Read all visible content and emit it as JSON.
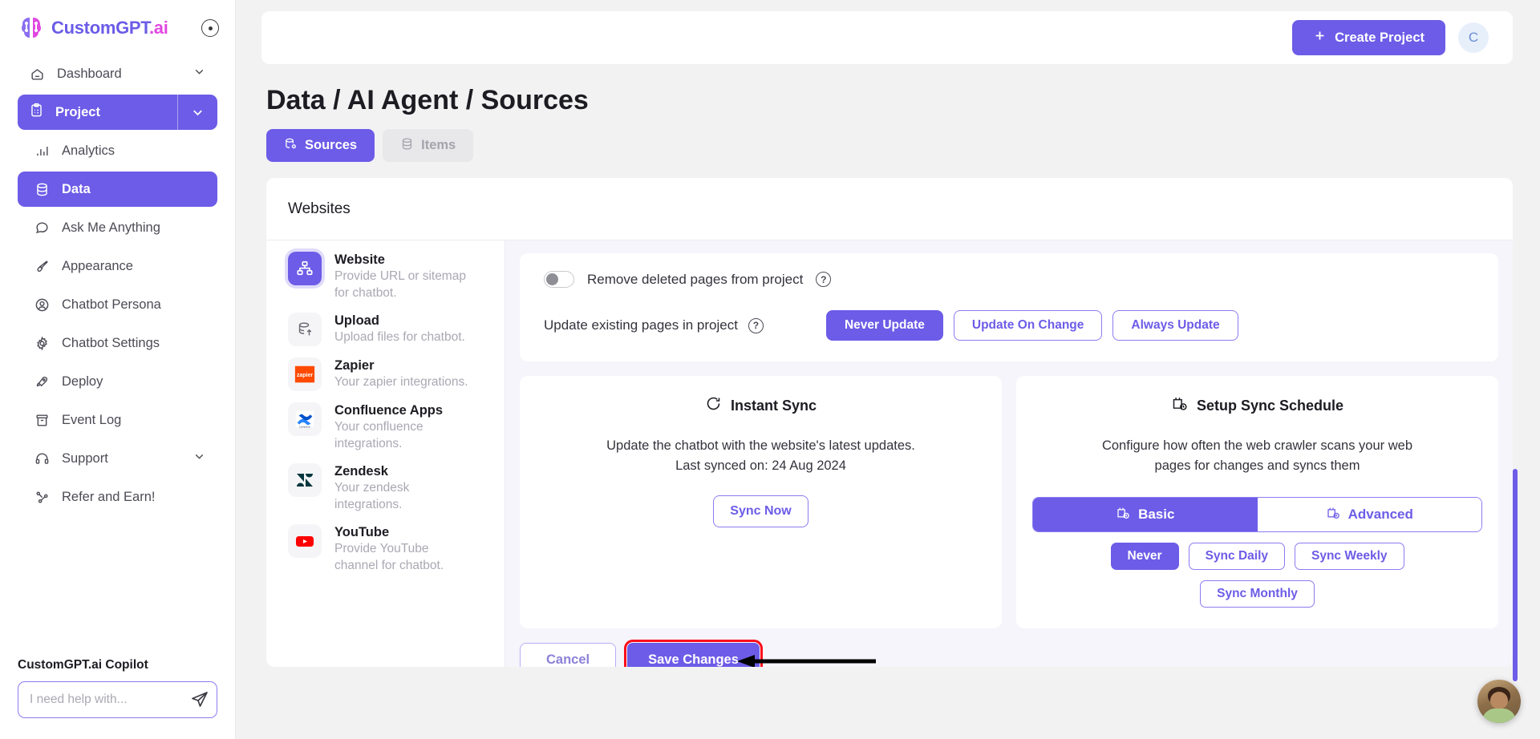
{
  "brand": {
    "name_part1": "CustomGPT",
    "name_part2": ".ai",
    "help_icon": "info-dot-icon"
  },
  "sidebar": {
    "items": [
      {
        "label": "Dashboard",
        "icon": "home-icon",
        "state": "default",
        "chevron": true
      },
      {
        "label": "Project",
        "icon": "clipboard-icon",
        "state": "active",
        "chevron": true
      },
      {
        "label": "Analytics",
        "icon": "bar-chart-icon",
        "state": "sub"
      },
      {
        "label": "Data",
        "icon": "database-icon",
        "state": "active-sub"
      },
      {
        "label": "Ask Me Anything",
        "icon": "chat-bubble-icon",
        "state": "sub"
      },
      {
        "label": "Appearance",
        "icon": "paint-brush-icon",
        "state": "sub"
      },
      {
        "label": "Chatbot Persona",
        "icon": "user-circle-icon",
        "state": "sub"
      },
      {
        "label": "Chatbot Settings",
        "icon": "gear-icon",
        "state": "sub"
      },
      {
        "label": "Deploy",
        "icon": "rocket-icon",
        "state": "sub"
      },
      {
        "label": "Event Log",
        "icon": "archive-icon",
        "state": "sub"
      },
      {
        "label": "Support",
        "icon": "headset-icon",
        "state": "sub",
        "chevron": true
      },
      {
        "label": "Refer and Earn!",
        "icon": "share-nodes-icon",
        "state": "sub"
      }
    ],
    "copilot": {
      "title": "CustomGPT.ai Copilot",
      "placeholder": "I need help with...",
      "value": "",
      "send_icon": "paper-plane-icon"
    }
  },
  "topbar": {
    "create_label": "Create Project",
    "create_icon": "plus-icon",
    "avatar_initial": "C"
  },
  "page": {
    "title": "Data / AI Agent / Sources",
    "tabs": [
      {
        "label": "Sources",
        "icon": "database-gear-icon",
        "active": true
      },
      {
        "label": "Items",
        "icon": "database-icon",
        "active": false
      }
    ],
    "panel_title": "Websites"
  },
  "sources": [
    {
      "name": "Website",
      "desc": "Provide URL or sitemap for chatbot.",
      "icon": "sitemap-icon",
      "selected": true
    },
    {
      "name": "Upload",
      "desc": "Upload files for chatbot.",
      "icon": "database-upload-icon",
      "selected": false
    },
    {
      "name": "Zapier",
      "desc": "Your zapier integrations.",
      "icon": "zapier-logo-icon",
      "selected": false
    },
    {
      "name": "Confluence Apps",
      "desc": "Your confluence integrations.",
      "icon": "confluence-logo-icon",
      "selected": false
    },
    {
      "name": "Zendesk",
      "desc": "Your zendesk integrations.",
      "icon": "zendesk-logo-icon",
      "selected": false
    },
    {
      "name": "YouTube",
      "desc": "Provide YouTube channel for chatbot.",
      "icon": "youtube-logo-icon",
      "selected": false
    }
  ],
  "settings": {
    "remove_deleted_label": "Remove deleted pages from project",
    "remove_deleted_enabled": false,
    "update_existing_label": "Update existing pages in project",
    "update_options": [
      {
        "label": "Never Update",
        "selected": true
      },
      {
        "label": "Update On Change",
        "selected": false
      },
      {
        "label": "Always Update",
        "selected": false
      }
    ],
    "help_icon": "question-circle-icon"
  },
  "instant_sync": {
    "title": "Instant Sync",
    "icon": "refresh-icon",
    "desc_line1": "Update the chatbot with the website's latest updates.",
    "desc_line2": "Last synced on: 24 Aug 2024",
    "button_label": "Sync Now"
  },
  "sync_schedule": {
    "title": "Setup Sync Schedule",
    "icon": "calendar-clock-icon",
    "desc_line1": "Configure how often the web crawler scans your web",
    "desc_line2": "pages for changes and syncs them",
    "modes": [
      {
        "label": "Basic",
        "icon": "calendar-clock-icon",
        "selected": true
      },
      {
        "label": "Advanced",
        "icon": "calendar-clock-icon",
        "selected": false
      }
    ],
    "frequencies": [
      {
        "label": "Never",
        "selected": true
      },
      {
        "label": "Sync Daily",
        "selected": false
      },
      {
        "label": "Sync Weekly",
        "selected": false
      },
      {
        "label": "Sync Monthly",
        "selected": false
      }
    ]
  },
  "footer": {
    "cancel_label": "Cancel",
    "save_label": "Save Changes",
    "annotation": "arrow-pointing-to-save"
  },
  "colors": {
    "accent": "#6c5ce7",
    "accent_light": "#8c7cf0",
    "highlight_red": "#fc0d1b",
    "brand_pink": "#e148e1",
    "page_bg": "#f2f2f3",
    "content_bg": "#f5f5fb"
  }
}
